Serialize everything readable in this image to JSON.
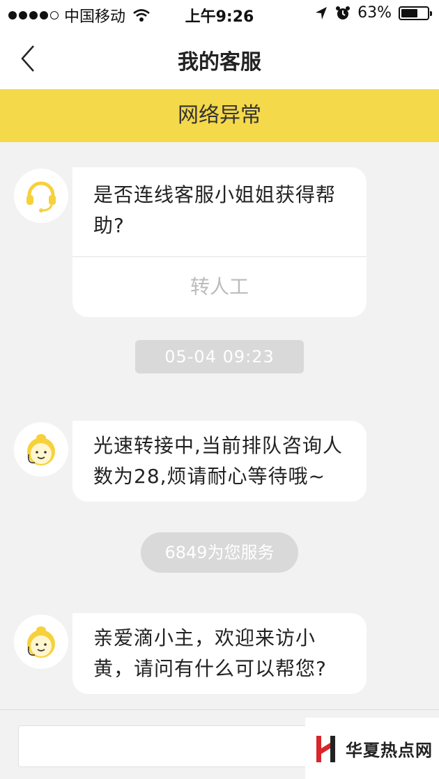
{
  "status_bar": {
    "carrier": "中国移动",
    "time": "上午9:26",
    "battery": "63%",
    "battery_level": 0.63
  },
  "nav": {
    "title": "我的客服"
  },
  "banner": {
    "text": "网络异常"
  },
  "messages": [
    {
      "text": "是否连线客服小姐姐获得帮助?",
      "action": "转人工"
    },
    {
      "text": "光速转接中,当前排队咨询人数为28,烦请耐心等待哦~"
    },
    {
      "text": "亲爱滴小主，欢迎来访小黄，请问有什么可以帮您?"
    }
  ],
  "timestamp": "05-04 09:23",
  "service_notice": "6849为您服务",
  "input": {
    "placeholder": ""
  },
  "watermark": {
    "text": "华夏热点网"
  },
  "colors": {
    "banner": "#f4d94a",
    "avatar_yellow": "#f7d13b"
  }
}
